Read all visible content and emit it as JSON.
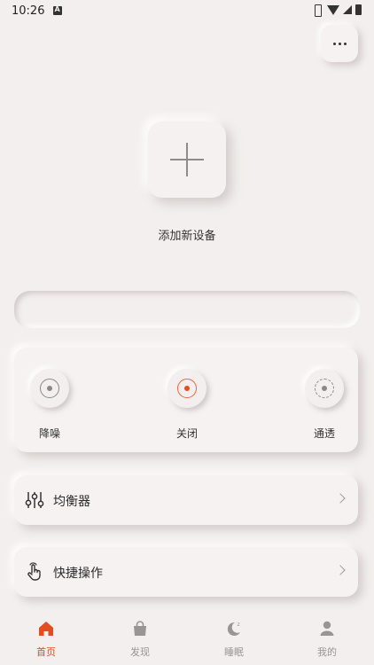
{
  "status_bar": {
    "time": "10:26"
  },
  "add_device": {
    "label": "添加新设备"
  },
  "modes": [
    {
      "label": "降噪",
      "icon": "anc-icon",
      "active": false
    },
    {
      "label": "关闭",
      "icon": "off-icon",
      "active": true
    },
    {
      "label": "通透",
      "icon": "transparency-icon",
      "active": false
    }
  ],
  "menu": [
    {
      "label": "均衡器",
      "icon": "equalizer-icon"
    },
    {
      "label": "快捷操作",
      "icon": "gesture-icon"
    }
  ],
  "bottom_nav": [
    {
      "label": "首页",
      "icon": "home-icon",
      "active": true
    },
    {
      "label": "发现",
      "icon": "bag-icon",
      "active": false
    },
    {
      "label": "睡眠",
      "icon": "moon-icon",
      "active": false
    },
    {
      "label": "我的",
      "icon": "profile-icon",
      "active": false
    }
  ],
  "colors": {
    "accent": "#e24d22",
    "background": "#f3efee",
    "muted": "#9a9594"
  }
}
